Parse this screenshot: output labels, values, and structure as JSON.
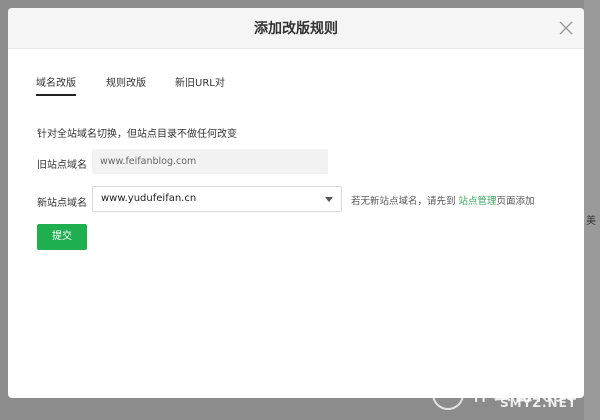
{
  "modal": {
    "title": "添加改版规则",
    "tabs": [
      {
        "label": "域名改版",
        "active": true
      },
      {
        "label": "规则改版",
        "active": false
      },
      {
        "label": "新旧URL对",
        "active": false
      }
    ],
    "description": "针对全站域名切换，但站点目录不做任何改变",
    "old_domain": {
      "label": "旧站点域名",
      "value": "www.feifanblog.com"
    },
    "new_domain": {
      "label": "新站点域名",
      "selected": "www.yudufeifan.cn"
    },
    "hint": {
      "prefix": "若无新站点域名，请先到 ",
      "link": "站点管理",
      "suffix": "页面添加"
    },
    "submit_label": "提交"
  },
  "background_peek_text": "美",
  "watermark": {
    "text": "什么值得买",
    "sub": "SMYZ.NET"
  },
  "colors": {
    "accent_green": "#1fae50",
    "link_green": "#3aa55a",
    "backdrop": "#8c8c8c"
  }
}
